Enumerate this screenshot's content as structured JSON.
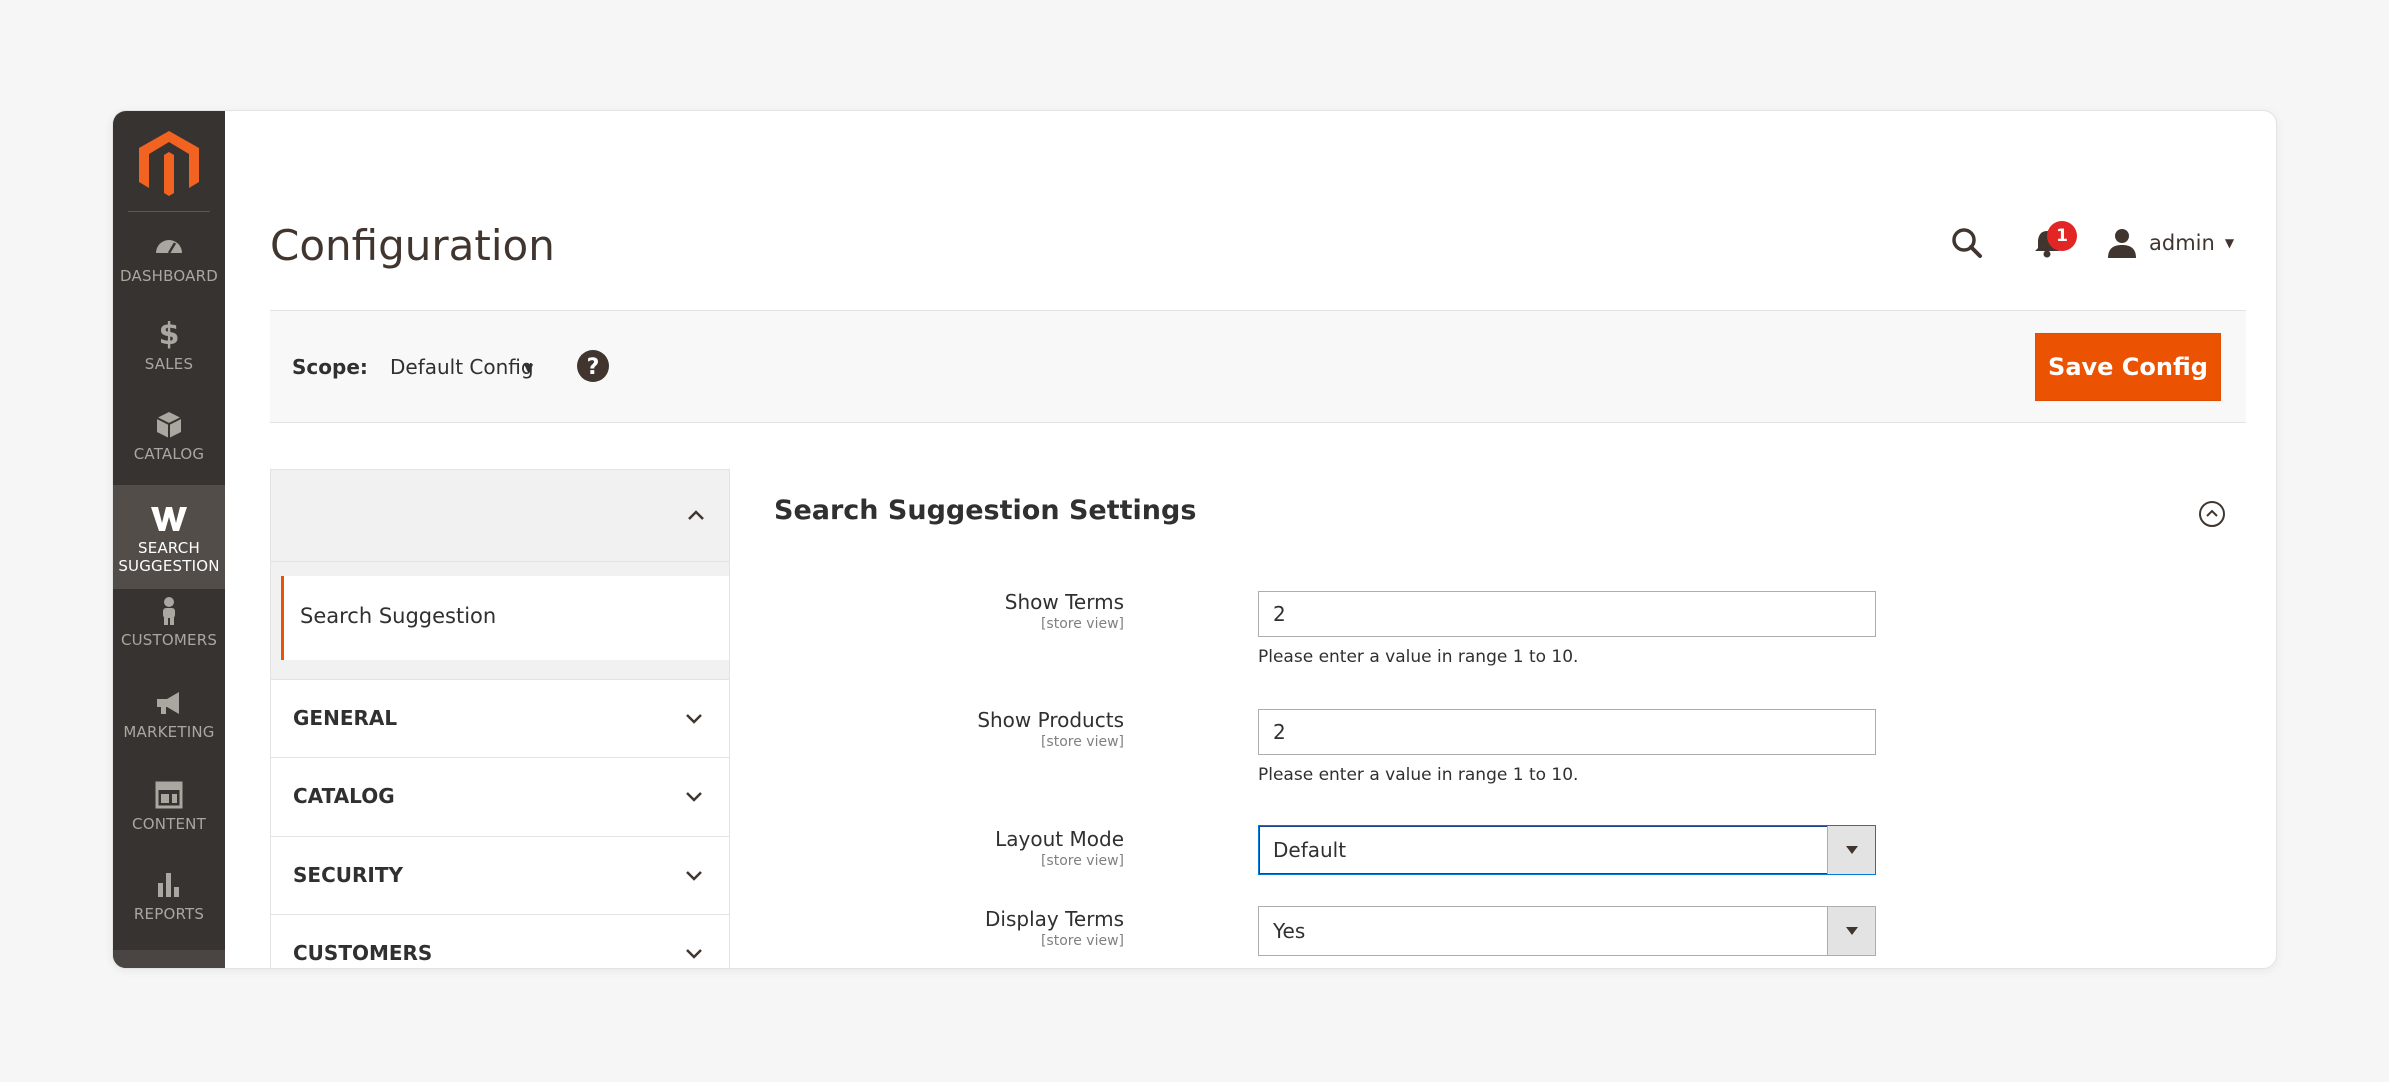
{
  "sidebar": {
    "logo": "magento-logo-icon",
    "items": [
      {
        "label": "DASHBOARD",
        "icon": "dashboard-icon",
        "active": false
      },
      {
        "label": "SALES",
        "icon": "dollar-icon",
        "active": false
      },
      {
        "label": "CATALOG",
        "icon": "box-icon",
        "active": false
      },
      {
        "label": "SEARCH SUGGESTION",
        "label_line1": "SEARCH",
        "label_line2": "SUGGESTION",
        "icon": "w-logo-icon",
        "active": true
      },
      {
        "label": "CUSTOMERS",
        "icon": "person-icon",
        "active": false
      },
      {
        "label": "MARKETING",
        "icon": "megaphone-icon",
        "active": false
      },
      {
        "label": "CONTENT",
        "icon": "layout-icon",
        "active": false
      },
      {
        "label": "REPORTS",
        "icon": "bar-chart-icon",
        "active": false
      }
    ]
  },
  "header": {
    "title": "Configuration",
    "notifications_count": "1",
    "user_name": "admin"
  },
  "scope": {
    "label": "Scope:",
    "value": "Default Config",
    "save_label": "Save Config"
  },
  "left_panel": {
    "active_item": "Search Suggestion",
    "sections": [
      "GENERAL",
      "CATALOG",
      "SECURITY",
      "CUSTOMERS"
    ]
  },
  "form": {
    "section_title": "Search Suggestion Settings",
    "fields": [
      {
        "label": "Show Terms",
        "scope": "[store view]",
        "value": "2",
        "note": "Please enter a value in range 1 to 10."
      },
      {
        "label": "Show Products",
        "scope": "[store view]",
        "value": "2",
        "note": "Please enter a value in range 1 to 10."
      },
      {
        "label": "Layout Mode",
        "scope": "[store view]",
        "value": "Default"
      },
      {
        "label": "Display Terms",
        "scope": "[store view]",
        "value": "Yes"
      }
    ]
  },
  "colors": {
    "sidebar_bg": "#373330",
    "accent": "#eb5202",
    "badge": "#e22626"
  }
}
